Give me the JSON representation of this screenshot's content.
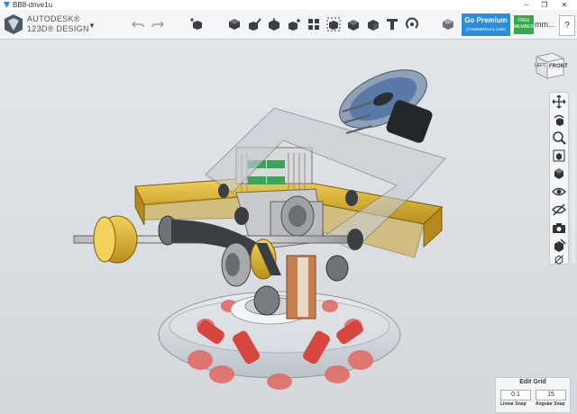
{
  "window": {
    "title": "BB8-drive1u",
    "controls": [
      "–",
      "❐",
      "✕"
    ]
  },
  "brand": {
    "line1": "AUTODESK®",
    "line2": "123D® DESIGN"
  },
  "toolbar": {
    "undo_icon": "undo-icon",
    "redo_icon": "redo-icon",
    "tools": [
      "primitives",
      "sketch",
      "construct",
      "modify",
      "pattern",
      "grouping",
      "combine",
      "measure",
      "text",
      "snap",
      "material"
    ]
  },
  "premium": {
    "label": "Go Premium",
    "sub": "(COMMERCIAL USE)"
  },
  "free": {
    "label": "FREE\nMEMBER"
  },
  "units": {
    "label": "mm..."
  },
  "help": {
    "label": "?"
  },
  "viewcube": {
    "left": "LEFT",
    "front": "FRONT"
  },
  "editgrid": {
    "title": "Edit Grid",
    "linear_value": "0.1",
    "angular_value": "15",
    "linear_label": "Linear Snap",
    "angular_label": "Angular Snap"
  },
  "colors": {
    "accent": "#2a8fd8",
    "free": "#37a84a",
    "frame": "#d8b52c"
  }
}
